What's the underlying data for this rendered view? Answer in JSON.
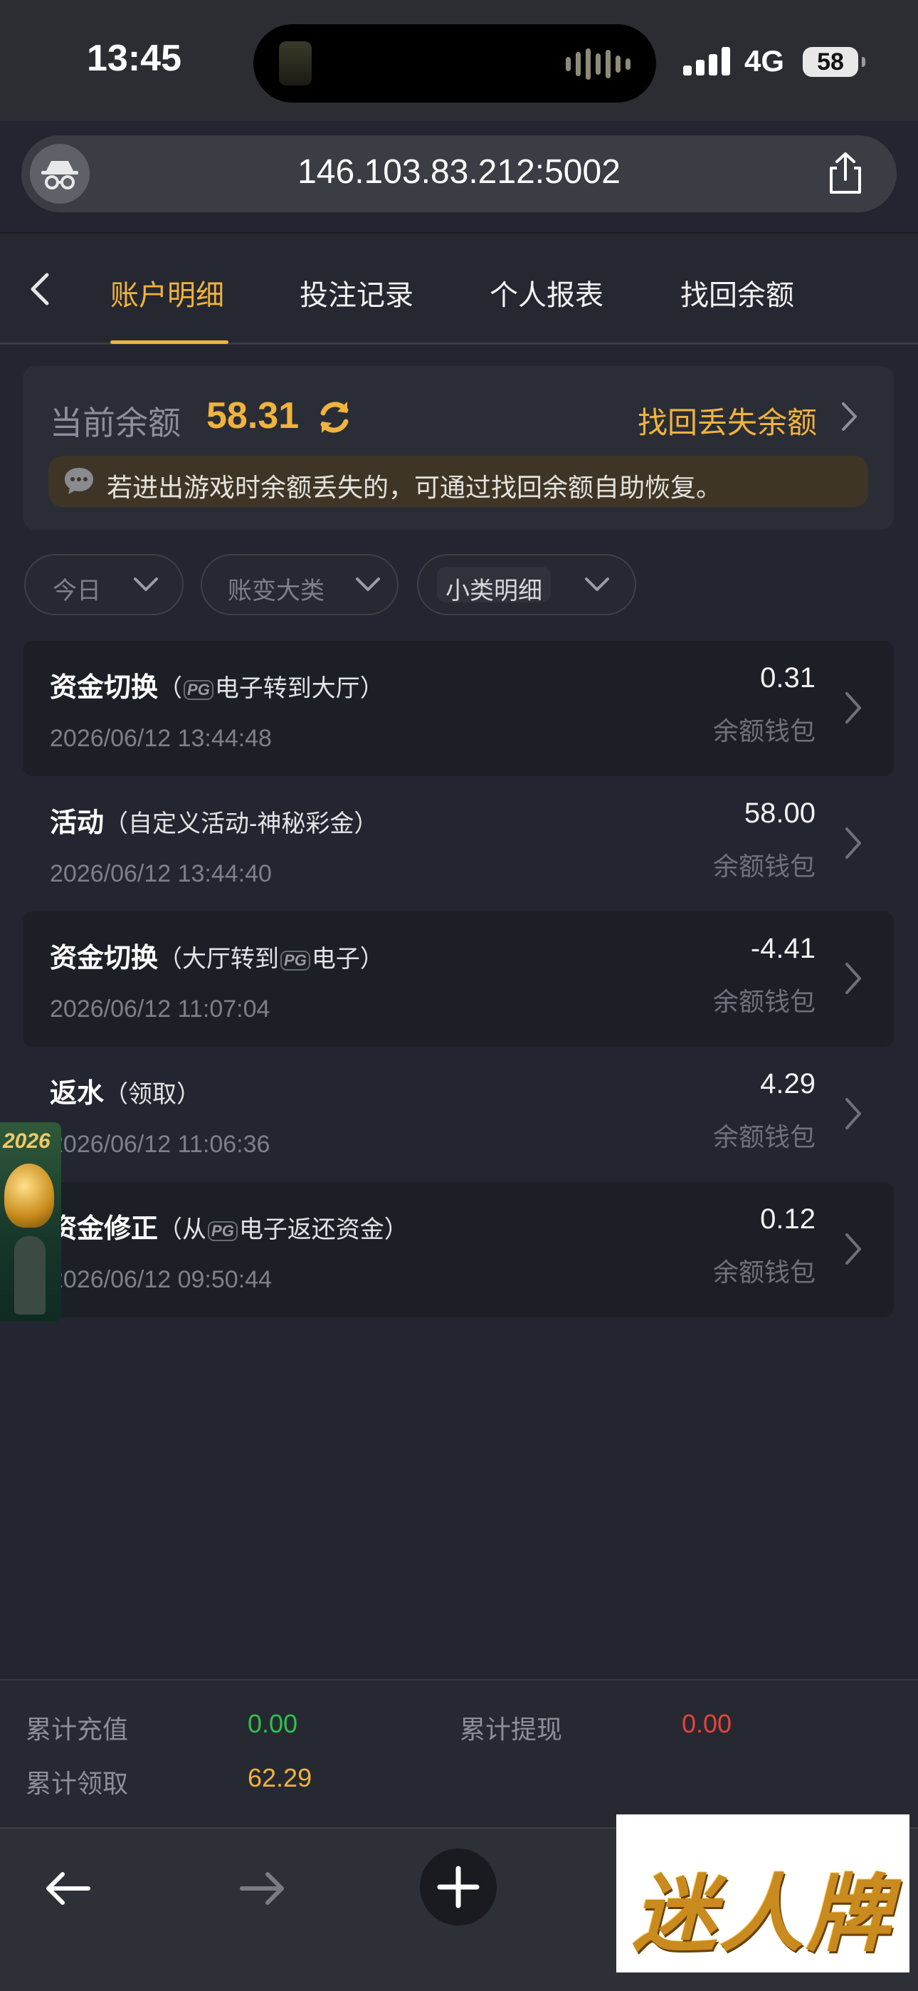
{
  "status_bar": {
    "time": "13:45",
    "network": "4G",
    "battery": "58"
  },
  "browser": {
    "url": "146.103.83.212:5002"
  },
  "tabs": [
    {
      "label": "账户明细",
      "active": true
    },
    {
      "label": "投注记录",
      "active": false
    },
    {
      "label": "个人报表",
      "active": false
    },
    {
      "label": "找回余额",
      "active": false
    }
  ],
  "balance": {
    "label": "当前余额",
    "value": "58.31",
    "recover_link": "找回丢失余额",
    "notice": "若进出游戏时余额丢失的，可通过找回余额自助恢复。"
  },
  "filters": [
    {
      "label": "今日",
      "selected": false
    },
    {
      "label": "账变大类",
      "selected": false
    },
    {
      "label": "小类明细",
      "selected": true
    }
  ],
  "records": [
    {
      "title": "资金切换",
      "sub_pre": "（",
      "sub_logo": "PG",
      "sub_post": "电子转到大厅）",
      "date": "2026/06/12 13:44:48",
      "amount": "0.31",
      "wallet": "余额钱包"
    },
    {
      "title": "活动",
      "sub_pre": "（自定义活动-神秘彩金）",
      "sub_logo": "",
      "sub_post": "",
      "date": "2026/06/12 13:44:40",
      "amount": "58.00",
      "wallet": "余额钱包"
    },
    {
      "title": "资金切换",
      "sub_pre": "（大厅转到",
      "sub_logo": "PG",
      "sub_post": "电子）",
      "date": "2026/06/12 11:07:04",
      "amount": "-4.41",
      "wallet": "余额钱包"
    },
    {
      "title": "返水",
      "sub_pre": "（领取）",
      "sub_logo": "",
      "sub_post": "",
      "date": "2026/06/12 11:06:36",
      "amount": "4.29",
      "wallet": "余额钱包"
    },
    {
      "title": "资金修正",
      "sub_pre": "（从",
      "sub_logo": "PG",
      "sub_post": "电子返还资金）",
      "date": "2026/06/12 09:50:44",
      "amount": "0.12",
      "wallet": "余额钱包"
    }
  ],
  "banner": {
    "year": "2026"
  },
  "summary": {
    "recharge_label": "累计充值",
    "recharge_value": "0.00",
    "withdraw_label": "累计提现",
    "withdraw_value": "0.00",
    "claim_label": "累计领取",
    "claim_value": "62.29"
  },
  "watermark": "迷人牌",
  "colors": {
    "accent": "#f0b33c",
    "positive": "#2ec24a",
    "negative": "#e5443a",
    "background": "#232630"
  }
}
